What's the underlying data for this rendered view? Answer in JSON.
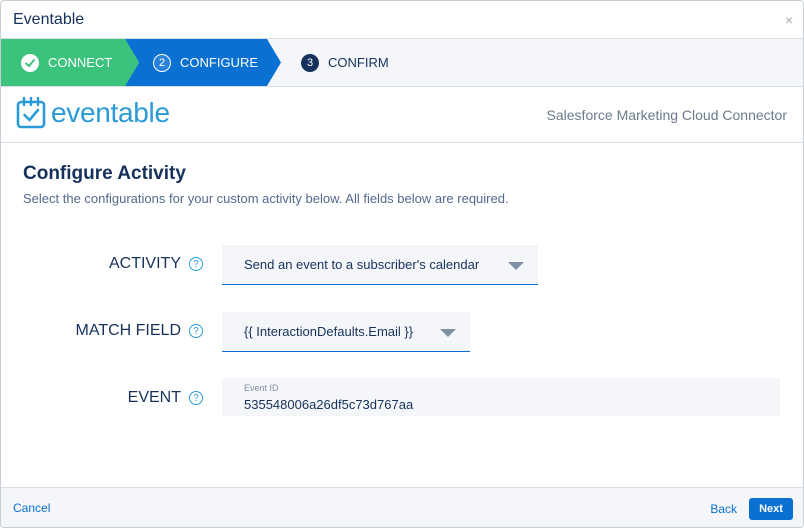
{
  "window": {
    "title": "Eventable",
    "close_glyph": "×"
  },
  "steps": [
    {
      "label": "CONNECT",
      "state": "complete",
      "icon": "check-icon"
    },
    {
      "label": "CONFIGURE",
      "state": "active",
      "number": "2"
    },
    {
      "label": "CONFIRM",
      "state": "pending",
      "number": "3"
    }
  ],
  "brand": {
    "logo_text": "eventable",
    "subtitle": "Salesforce Marketing Cloud Connector"
  },
  "content": {
    "title": "Configure Activity",
    "description": "Select the configurations for your custom activity below. All fields below are required."
  },
  "fields": {
    "activity": {
      "label": "ACTIVITY",
      "value": "Send an event to a subscriber's calendar",
      "help": "?"
    },
    "match_field": {
      "label": "MATCH FIELD",
      "value": "{{ InteractionDefaults.Email }}",
      "help": "?"
    },
    "event": {
      "label": "EVENT",
      "sub_label": "Event ID",
      "value": "535548006a26df5c73d767aa",
      "help": "?"
    }
  },
  "footer": {
    "cancel": "Cancel",
    "back": "Back",
    "next": "Next"
  },
  "colors": {
    "connect_green": "#3bc27c",
    "configure_blue": "#0a70d2",
    "logo_blue": "#2a9bd6",
    "text_navy": "#16325c"
  }
}
